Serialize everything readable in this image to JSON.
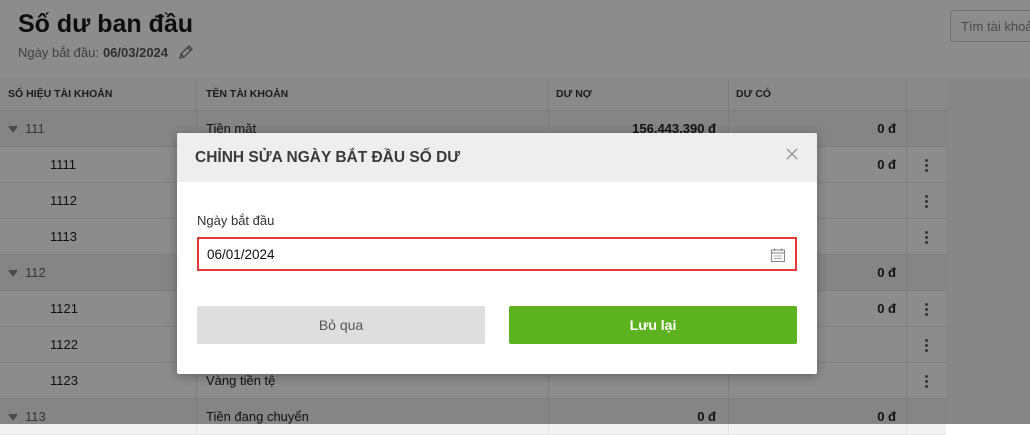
{
  "page": {
    "title": "Số dư ban đầu",
    "start_date_label": "Ngày bắt đầu:",
    "start_date_value": "06/03/2024",
    "search_placeholder": "Tìm tài khoả"
  },
  "table": {
    "columns": [
      "SỐ HIỆU TÀI KHOẢN",
      "TÊN TÀI KHOẢN",
      "DƯ NỢ",
      "DƯ CÓ"
    ],
    "rows": [
      {
        "code": "111",
        "name": "Tiền mặt",
        "debit": "156.443.390 đ",
        "credit": "0 đ"
      },
      {
        "code": "1111",
        "name": "",
        "debit": "",
        "credit": "0 đ"
      },
      {
        "code": "1112",
        "name": "",
        "debit": "",
        "credit": ""
      },
      {
        "code": "1113",
        "name": "",
        "debit": "",
        "credit": ""
      },
      {
        "code": "112",
        "name": "",
        "debit": "",
        "credit": "0 đ"
      },
      {
        "code": "1121",
        "name": "",
        "debit": "",
        "credit": "0 đ"
      },
      {
        "code": "1122",
        "name": "",
        "debit": "",
        "credit": ""
      },
      {
        "code": "1123",
        "name": "Vàng tiền tệ",
        "debit": "",
        "credit": ""
      },
      {
        "code": "113",
        "name": "Tiền đang chuyển",
        "debit": "0 đ",
        "credit": "0 đ"
      }
    ]
  },
  "modal": {
    "title": "CHỈNH SỬA NGÀY BẮT ĐẦU SỐ DƯ",
    "field_label": "Ngày bắt đầu",
    "date_value": "06/01/2024",
    "cancel_label": "Bỏ qua",
    "save_label": "Lưu lại"
  },
  "colors": {
    "primary": "#5cb31f",
    "error_border": "#e03a3a",
    "overlay": "rgba(0,0,0,0.45)"
  },
  "icons": [
    "pencil-icon",
    "caret-down-icon",
    "kebab-menu-icon",
    "close-icon",
    "calendar-icon"
  ]
}
